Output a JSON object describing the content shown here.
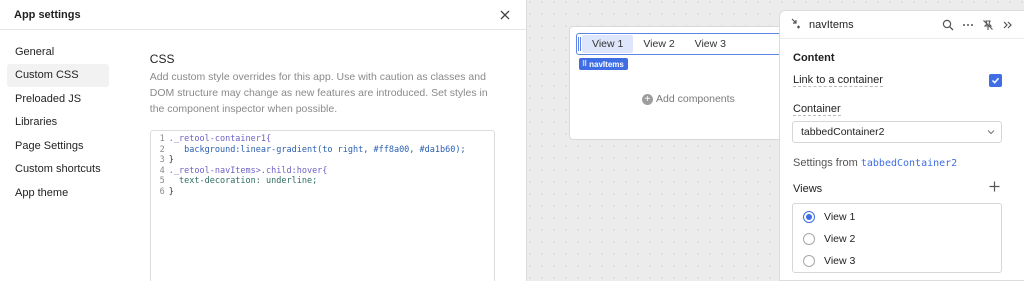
{
  "modal": {
    "title": "App settings",
    "nav": [
      {
        "label": "General"
      },
      {
        "label": "Custom CSS",
        "active": true
      },
      {
        "label": "Preloaded JS"
      },
      {
        "label": "Libraries"
      },
      {
        "label": "Page Settings"
      },
      {
        "label": "Custom shortcuts"
      },
      {
        "label": "App theme"
      }
    ],
    "section_title": "CSS",
    "description": "Add custom style overrides for this app. Use with caution as classes and DOM structure may change as new features are introduced. Set styles in the component inspector when possible.",
    "code_lines": [
      {
        "num": "1",
        "text": "._retool-container1{"
      },
      {
        "num": "2",
        "text": "   background:linear-gradient(to right, #ff8a00, #da1b60);"
      },
      {
        "num": "3",
        "text": "}"
      },
      {
        "num": "4",
        "text": "._retool-navItems>.child:hover{"
      },
      {
        "num": "5",
        "text": "  text-decoration: underline;"
      },
      {
        "num": "6",
        "text": "}"
      }
    ]
  },
  "canvas": {
    "tabs": [
      {
        "label": "View 1",
        "active": true
      },
      {
        "label": "View 2"
      },
      {
        "label": "View 3"
      }
    ],
    "component_tag": "navItems",
    "add_components": "Add components"
  },
  "inspector": {
    "title": "navItems",
    "section": "Content",
    "link_to_container": "Link to a container",
    "link_checked": true,
    "container_label": "Container",
    "container_value": "tabbedContainer2",
    "settings_from_prefix": "Settings from ",
    "settings_from_value": "tabbedContainer2",
    "views_label": "Views",
    "views": [
      {
        "label": "View 1",
        "selected": true
      },
      {
        "label": "View 2"
      },
      {
        "label": "View 3"
      }
    ]
  },
  "colors": {
    "accent": "#3f6ee4",
    "canvas_bg": "#ececec"
  }
}
